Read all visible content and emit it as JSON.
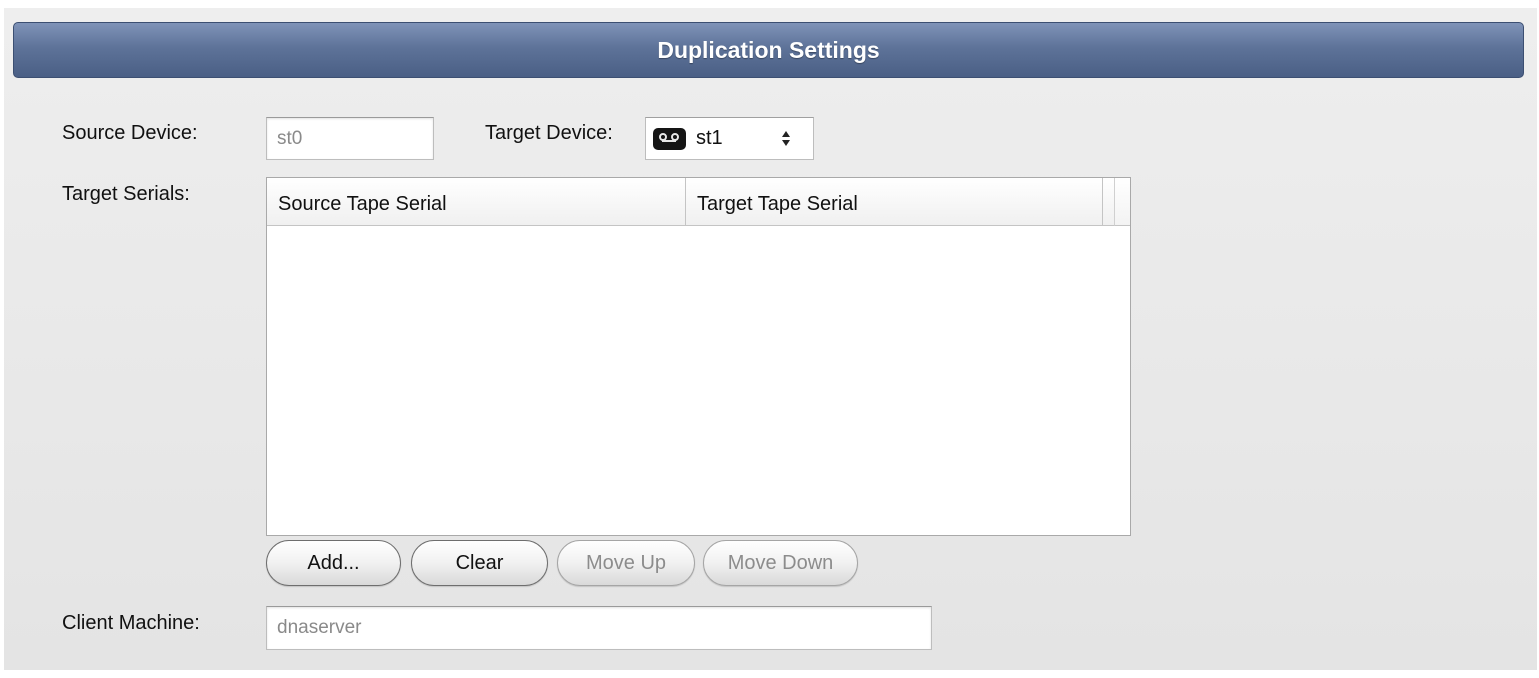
{
  "title": "Duplication Settings",
  "source_device": {
    "label": "Source Device:",
    "value": "st0"
  },
  "target_device": {
    "label": "Target Device:",
    "value": "st1",
    "icon": "tape-drive-icon"
  },
  "target_serials": {
    "label": "Target Serials:",
    "columns": [
      "Source Tape Serial",
      "Target Tape Serial"
    ],
    "rows": []
  },
  "buttons": {
    "add": "Add...",
    "clear": "Clear",
    "move_up": "Move Up",
    "move_down": "Move Down"
  },
  "client_machine": {
    "label": "Client Machine:",
    "value": "dnaserver"
  }
}
